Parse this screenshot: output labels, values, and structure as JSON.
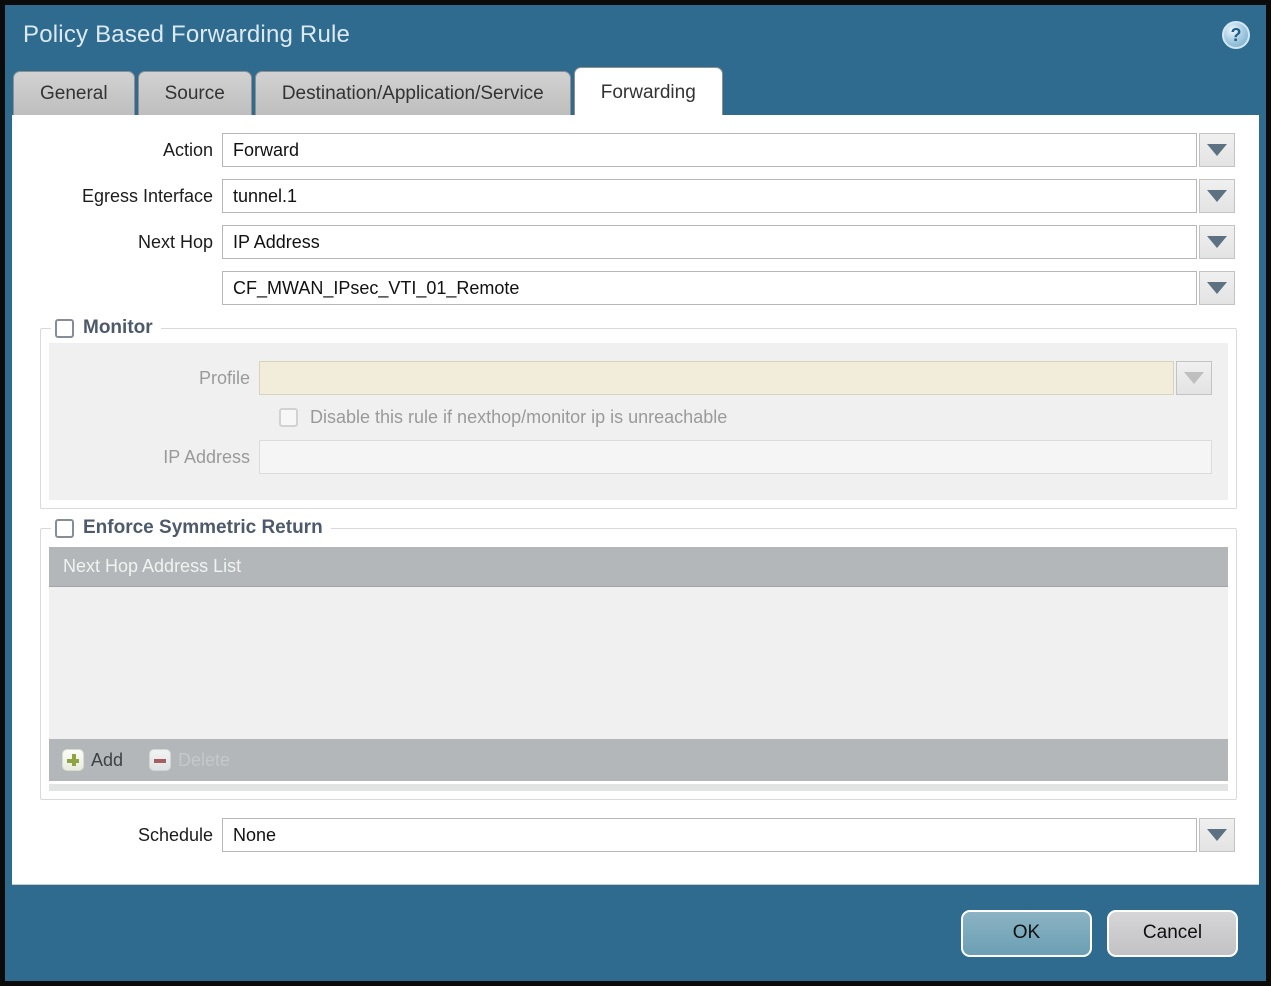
{
  "dialog": {
    "title": "Policy Based Forwarding Rule",
    "help_glyph": "?"
  },
  "tabs": [
    {
      "label": "General",
      "active": false
    },
    {
      "label": "Source",
      "active": false
    },
    {
      "label": "Destination/Application/Service",
      "active": false
    },
    {
      "label": "Forwarding",
      "active": true
    }
  ],
  "form": {
    "action": {
      "label": "Action",
      "value": "Forward"
    },
    "egress_interface": {
      "label": "Egress Interface",
      "value": "tunnel.1"
    },
    "next_hop": {
      "label": "Next Hop",
      "value": "IP Address"
    },
    "next_hop_address": {
      "value": "CF_MWAN_IPsec_VTI_01_Remote"
    },
    "schedule": {
      "label": "Schedule",
      "value": "None"
    }
  },
  "monitor": {
    "legend": "Monitor",
    "checked": false,
    "profile": {
      "label": "Profile",
      "value": ""
    },
    "disable_rule": {
      "label": "Disable this rule if nexthop/monitor ip is unreachable",
      "checked": false
    },
    "ip_address": {
      "label": "IP Address",
      "value": ""
    }
  },
  "symmetric_return": {
    "legend": "Enforce Symmetric Return",
    "checked": false,
    "table": {
      "header": "Next Hop Address List",
      "rows": []
    },
    "add_label": "Add",
    "delete_label": "Delete"
  },
  "footer": {
    "ok_label": "OK",
    "cancel_label": "Cancel"
  },
  "colors": {
    "titlebar": "#2e6b8e",
    "ok_button": "#6b9fb4",
    "cream_field": "#f2ecdb",
    "table_gray": "#b3b7b9"
  }
}
